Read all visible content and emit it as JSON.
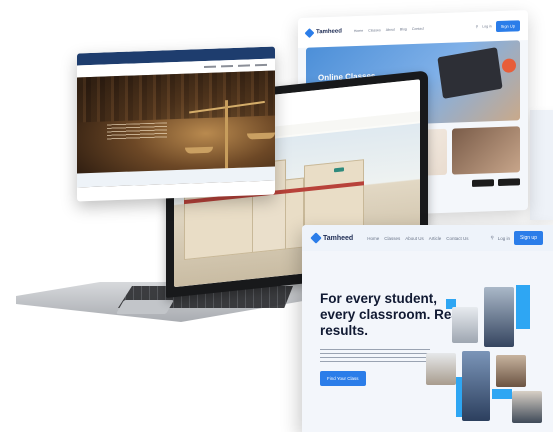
{
  "online_card": {
    "brand": "Tamheed",
    "nav_links": [
      "Home",
      "Classes",
      "About",
      "Blog",
      "Contact"
    ],
    "login": "Log in",
    "signup": "Sign Up",
    "hero_title": "Online Classes"
  },
  "law_card": {
    "topbar": "",
    "hero_title": "",
    "footer": ""
  },
  "laptop_site": {
    "logo_text": "",
    "tabs": [
      "",
      "",
      "",
      "",
      "",
      ""
    ],
    "banner": "",
    "banner_sub": ""
  },
  "tamheed_card": {
    "brand": "Tamheed",
    "nav_links": [
      "Home",
      "Classes",
      "About Us",
      "Article",
      "Contact Us"
    ],
    "login": "Log in",
    "signup": "Sign up",
    "headline": "For every student, every classroom. Real results.",
    "cta": "Find Your Class"
  },
  "colors": {
    "brand_blue": "#2b7de9",
    "accent_cyan": "#2ea6f3",
    "law_navy": "#1e3d6e",
    "school_green": "#2e8a7d"
  }
}
